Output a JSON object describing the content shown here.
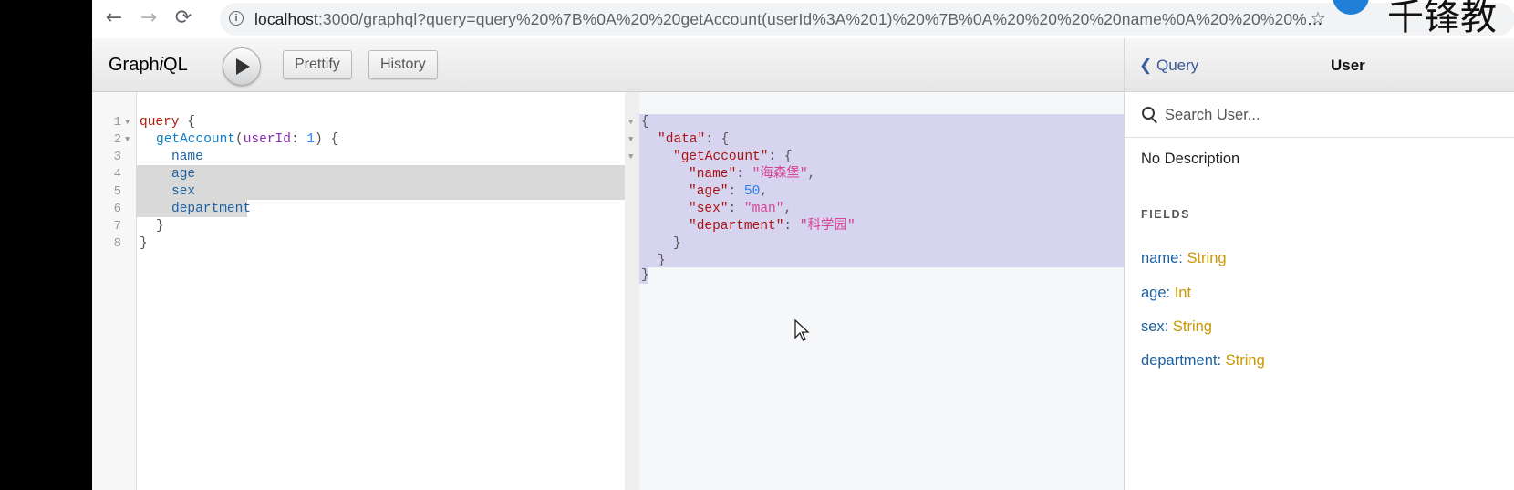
{
  "browser": {
    "back_glyph": "←",
    "forward_glyph": "→",
    "reload_glyph": "⟳",
    "url_host": "localhost",
    "url_rest": ":3000/graphql?query=query%20%7B%0A%20%20getAccount(userId%3A%201)%20%7B%0A%20%20%20%20name%0A%20%20%20%20...",
    "star_glyph": "☆",
    "watermark_text": "千锋教"
  },
  "toolbar": {
    "logo_prefix": "Graph",
    "logo_italic": "i",
    "logo_suffix": "QL",
    "prettify_label": "Prettify",
    "history_label": "History"
  },
  "query_editor": {
    "line_numbers": [
      "1",
      "2",
      "3",
      "4",
      "5",
      "6",
      "7",
      "8"
    ],
    "lines": [
      {
        "kw": "query",
        "rest": " {"
      },
      {
        "fn": "getAccount",
        "p1": "(",
        "arg": "userId",
        "p2": ": ",
        "num": "1",
        "p3": ") {"
      },
      {
        "fld": "name"
      },
      {
        "fld": "age"
      },
      {
        "fld": "sex"
      },
      {
        "fld": "department"
      },
      {
        "punct": "}"
      },
      {
        "punct": "}"
      }
    ]
  },
  "result": {
    "lines": {
      "l1": "{",
      "l2_key": "\"data\"",
      "l2_rest": ": {",
      "l3_key": "\"getAccount\"",
      "l3_rest": ": {",
      "l4_key": "\"name\"",
      "l4_sep": ": ",
      "l4_val": "\"海森堡\"",
      "l4_end": ",",
      "l5_key": "\"age\"",
      "l5_sep": ": ",
      "l5_val": "50",
      "l5_end": ",",
      "l6_key": "\"sex\"",
      "l6_sep": ": ",
      "l6_val": "\"man\"",
      "l6_end": ",",
      "l7_key": "\"department\"",
      "l7_sep": ": ",
      "l7_val": "\"科学园\"",
      "l8": "}",
      "l9": "}",
      "l10": "}"
    }
  },
  "docs": {
    "back_label": "Query",
    "title": "User",
    "search_placeholder": "Search User...",
    "description": "No Description",
    "fields_heading": "FIELDS",
    "fields": [
      {
        "name": "name",
        "type": "String"
      },
      {
        "name": "age",
        "type": "Int"
      },
      {
        "name": "sex",
        "type": "String"
      },
      {
        "name": "department",
        "type": "String"
      }
    ]
  },
  "colors": {
    "keyword": "#b11a04",
    "field": "#1f61a0",
    "type": "#CA9800",
    "string": "#d64292",
    "selection_result": "#d7d4f0"
  }
}
